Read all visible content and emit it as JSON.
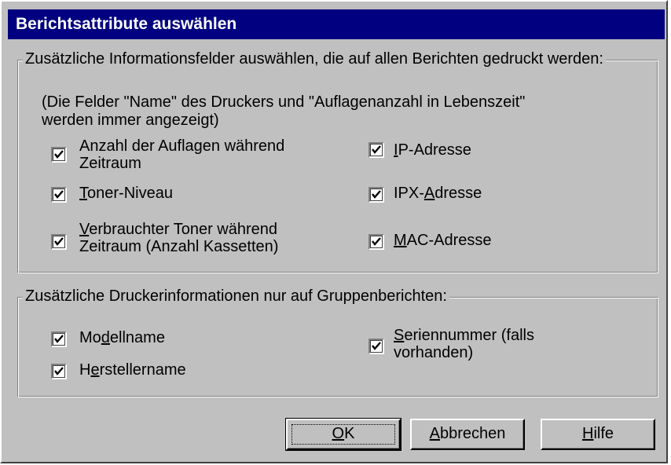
{
  "window": {
    "title": "Berichtsattribute auswählen"
  },
  "info_group": {
    "legend": "Zusätzliche Informationsfelder auswählen, die auf allen Berichten gedruckt werden:",
    "note_line1": "(Die Felder \"Name\" des Druckers und \"Auflagenanzahl in Lebenszeit\"",
    "note_line2": "werden immer angezeigt)",
    "items": [
      {
        "pre": "",
        "acc": "",
        "post": "Anzahl der Auflagen während",
        "line2": "Zeitraum",
        "checked": true
      },
      {
        "pre": "",
        "acc": "T",
        "post": "oner-Niveau",
        "line2": "",
        "checked": true
      },
      {
        "pre": "",
        "acc": "V",
        "post": "erbrauchter Toner während",
        "line2": "Zeitraum (Anzahl Kassetten)",
        "checked": true
      },
      {
        "pre": "",
        "acc": "I",
        "post": "P-Adresse",
        "line2": "",
        "checked": true
      },
      {
        "pre": "IPX-",
        "acc": "A",
        "post": "dresse",
        "line2": "",
        "checked": true
      },
      {
        "pre": "",
        "acc": "M",
        "post": "AC-Adresse",
        "line2": "",
        "checked": true
      }
    ]
  },
  "group_reports": {
    "legend": "Zusätzliche Druckerinformationen nur auf Gruppenberichten:",
    "items": [
      {
        "pre": "Mo",
        "acc": "d",
        "post": "ellname",
        "line2": "",
        "checked": true
      },
      {
        "pre": "H",
        "acc": "e",
        "post": "rstellername",
        "line2": "",
        "checked": true
      },
      {
        "pre": "",
        "acc": "S",
        "post": "eriennummer (falls",
        "line2": "vorhanden)",
        "checked": true
      }
    ]
  },
  "buttons": {
    "ok": {
      "acc": "O",
      "post": "K"
    },
    "cancel": {
      "acc": "A",
      "post": "bbrechen"
    },
    "help": {
      "acc": "H",
      "post": "ilfe"
    }
  },
  "colors": {
    "titlebar": "#000080",
    "face": "#c0c0c0"
  },
  "icons": {
    "checkmark": "checkmark-icon"
  }
}
